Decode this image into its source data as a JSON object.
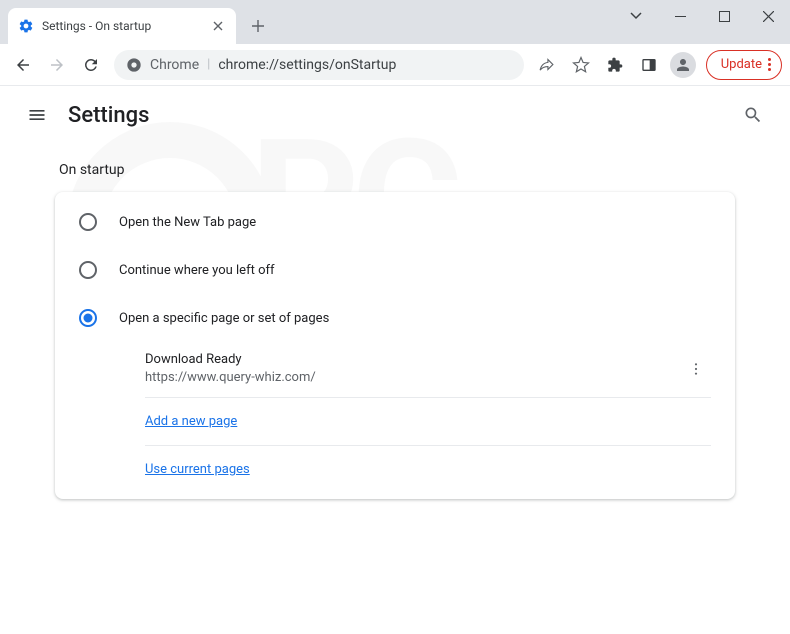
{
  "tab": {
    "title": "Settings - On startup"
  },
  "url": {
    "prefix": "Chrome",
    "path": "chrome://settings/onStartup"
  },
  "toolbar": {
    "update": "Update"
  },
  "header": {
    "title": "Settings"
  },
  "section": {
    "title": "On startup",
    "options": [
      {
        "label": "Open the New Tab page",
        "selected": false
      },
      {
        "label": "Continue where you left off",
        "selected": false
      },
      {
        "label": "Open a specific page or set of pages",
        "selected": true
      }
    ],
    "pages": [
      {
        "name": "Download Ready",
        "url": "https://www.query-whiz.com/"
      }
    ],
    "addLink": "Add a new page",
    "useLink": "Use current pages"
  }
}
